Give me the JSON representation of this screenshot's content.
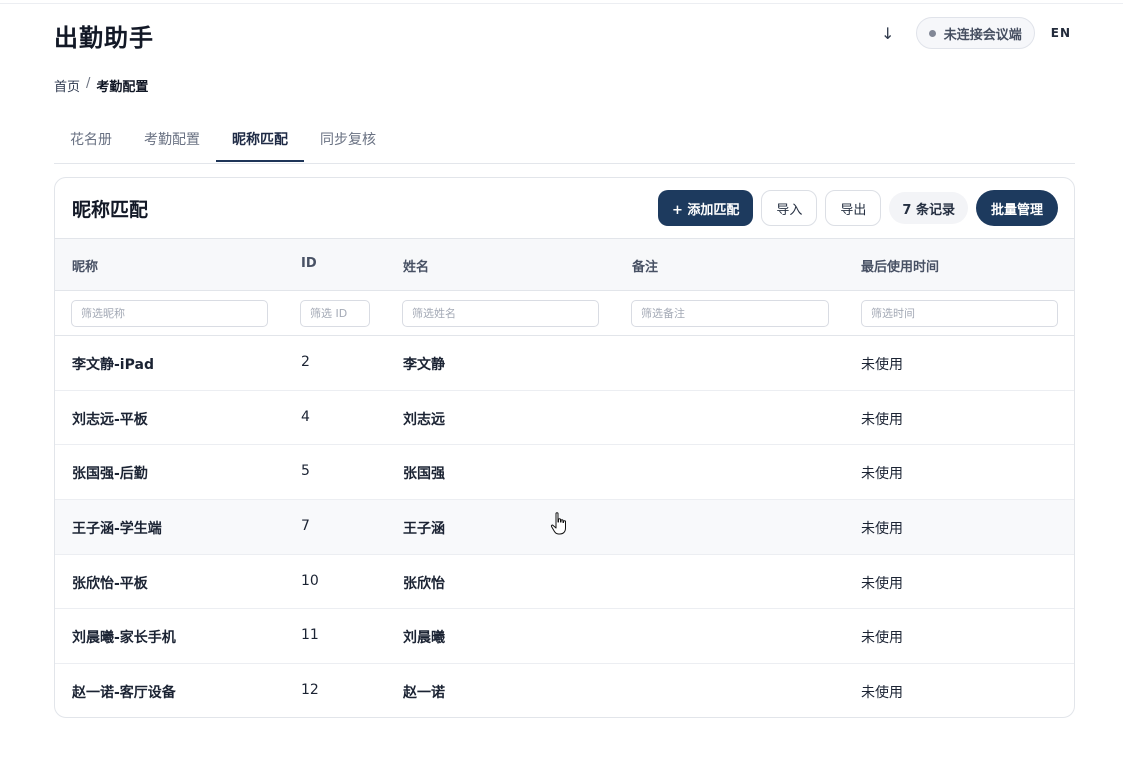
{
  "app": {
    "title": "出勤助手"
  },
  "header": {
    "download_icon": "↓",
    "status": {
      "label": "未连接会议端",
      "dot_color": "#818796"
    },
    "lang": "EN"
  },
  "breadcrumb": {
    "home": "首页",
    "sep": "/",
    "current": "考勤配置"
  },
  "tabs": [
    {
      "label": "花名册",
      "active": false
    },
    {
      "label": "考勤配置",
      "active": false
    },
    {
      "label": "昵称匹配",
      "active": true
    },
    {
      "label": "同步复核",
      "active": false
    }
  ],
  "card": {
    "title": "昵称匹配",
    "add_label": "+ 添加匹配",
    "import_label": "导入",
    "export_label": "导出",
    "count_label": "7 条记录",
    "batch_label": "批量管理"
  },
  "table": {
    "headers": [
      "昵称",
      "ID",
      "姓名",
      "备注",
      "最后使用时间"
    ],
    "filters": [
      "筛选昵称",
      "筛选 ID",
      "筛选姓名",
      "筛选备注",
      "筛选时间"
    ],
    "rows": [
      {
        "nickname": "李文静-iPad",
        "id": "2",
        "name": "李文静",
        "note": "",
        "last_used": "未使用"
      },
      {
        "nickname": "刘志远-平板",
        "id": "4",
        "name": "刘志远",
        "note": "",
        "last_used": "未使用"
      },
      {
        "nickname": "张国强-后勤",
        "id": "5",
        "name": "张国强",
        "note": "",
        "last_used": "未使用"
      },
      {
        "nickname": "王子涵-学生端",
        "id": "7",
        "name": "王子涵",
        "note": "",
        "last_used": "未使用"
      },
      {
        "nickname": "张欣怡-平板",
        "id": "10",
        "name": "张欣怡",
        "note": "",
        "last_used": "未使用"
      },
      {
        "nickname": "刘晨曦-家长手机",
        "id": "11",
        "name": "刘晨曦",
        "note": "",
        "last_used": "未使用"
      },
      {
        "nickname": "赵一诺-客厅设备",
        "id": "12",
        "name": "赵一诺",
        "note": "",
        "last_used": "未使用"
      }
    ]
  },
  "colors": {
    "primary": "#1d3a5e",
    "border": "#e2e5ea",
    "header_bg": "#f7f8fa"
  }
}
